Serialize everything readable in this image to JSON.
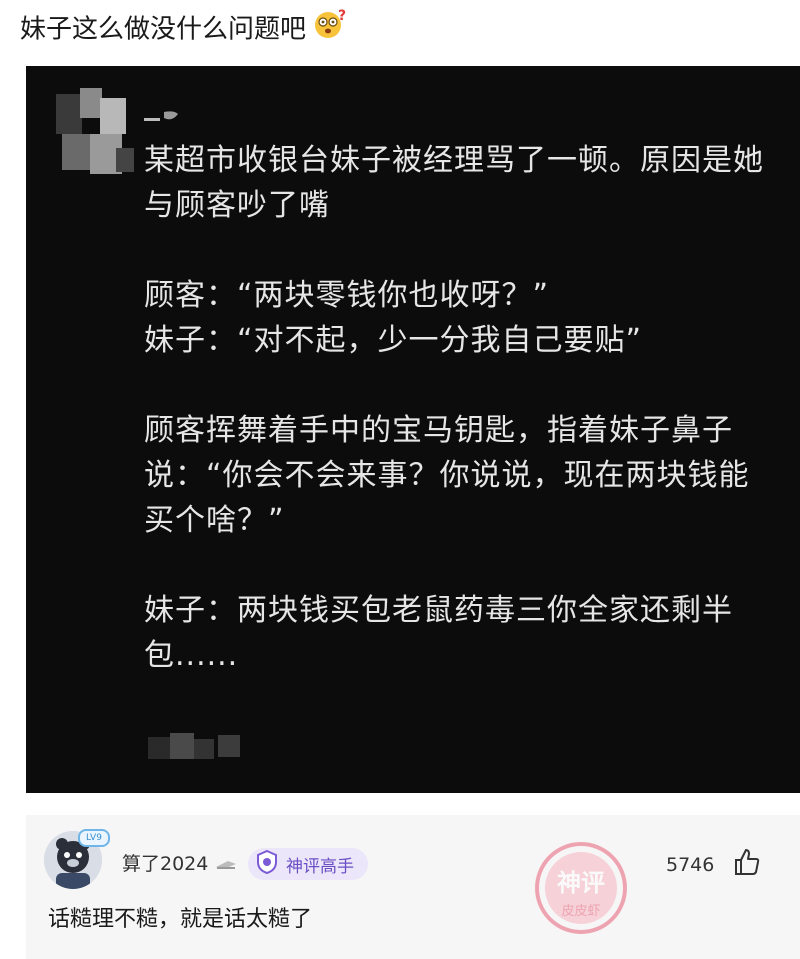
{
  "post": {
    "title": "妹子这么做没什么问题吧",
    "emoji_icon": "dizzy-face-emoji-icon"
  },
  "screenshot": {
    "paragraphs": [
      "某超市收银台妹子被经理骂了一顿。原因是她与顾客吵了嘴",
      "",
      "顾客：“两块零钱你也收呀？”",
      "妹子：“对不起，少一分我自己要贴”",
      "",
      "顾客挥舞着手中的宝马钥匙，指着妹子鼻子说：“你会不会来事？你说说，现在两块钱能买个啥？”",
      "",
      "妹子：两块钱买包老鼠药毒三你全家还剩半包......"
    ],
    "colors": {
      "background": "#0c0c0c",
      "text": "#e6e6e6"
    }
  },
  "comment": {
    "username": "算了2024",
    "level": "LV9",
    "tag": "神评高手",
    "text": "话糙理不糙，就是话太糙了",
    "likes": "5746",
    "stamp_text_top": "神评",
    "stamp_text_bottom": "皮皮虾",
    "colors": {
      "tag_bg": "#ece6fa",
      "tag_text": "#6b4fc4",
      "stamp": "#e8607a"
    }
  }
}
